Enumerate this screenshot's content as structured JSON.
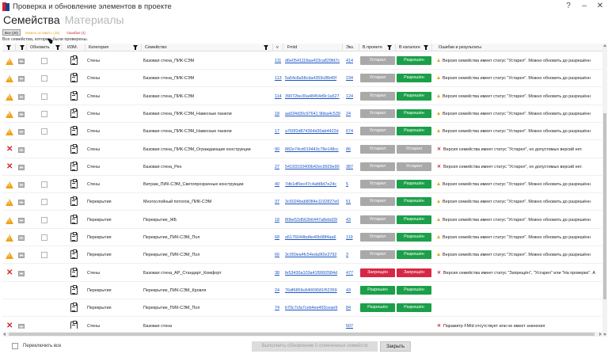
{
  "window": {
    "title": "Проверка и обновление элементов в проекте",
    "help": "?",
    "minimize": "–",
    "close": "✕"
  },
  "tabs": [
    {
      "label": "Семейства"
    },
    {
      "label": "Материалы"
    }
  ],
  "filters": {
    "all": "Все (20)",
    "warnings": "Можно оставить (15)",
    "errors": "Ошибки (4)"
  },
  "status_message": "Все семейства, которые были проверены.",
  "columns": {
    "update": "Обновить",
    "izm": "ИЗМ.",
    "category": "Категория",
    "family": "Семейство",
    "v": "v",
    "fmid": "FmId",
    "copies": "Экз.",
    "in_project": "В проекте",
    "in_catalog": "В каталоге",
    "results": "Ошибки и результаты"
  },
  "colors": {
    "warning": "#f0a21a",
    "error": "#d62828",
    "green": "#1b9f49",
    "gray": "#a9a9a9",
    "red": "#d62846",
    "link": "#1a55c4"
  },
  "rows": [
    {
      "status": "warning",
      "category": "Стены",
      "family": "Базовая стена_ПИК-СЭМ",
      "v": "111",
      "fmid": "d6e0541118aa433ca829fd7c",
      "copies": "414",
      "in_project": "Устарел",
      "in_project_color": "gray",
      "in_catalog": "Разрешён",
      "in_catalog_color": "green",
      "result": "Версия семейства имеет статус \"Устарел\". Можно обновить до разрешённ"
    },
    {
      "status": "warning",
      "category": "Стены",
      "family": "Базовая стена_ПИК-СЭМ",
      "v": "113",
      "fmid": "5a54c8a58cda4359c8fb40f",
      "copies": "234",
      "in_project": "Устарел",
      "in_project_color": "gray",
      "in_catalog": "Разрешён",
      "in_catalog_color": "green",
      "result": "Версия семейства имеет статус \"Устарел\". Можно обновить до разрешённ"
    },
    {
      "status": "warning",
      "category": "Стены",
      "family": "Базовая стена_ПИК-СЭМ",
      "v": "114",
      "fmid": "39072be30a48454d9c1a527",
      "copies": "124",
      "in_project": "Устарел",
      "in_project_color": "gray",
      "in_catalog": "Разрешён",
      "in_catalog_color": "green",
      "result": "Версия семейства имеет статус \"Устарел\". Можно обновить до разрешённ"
    },
    {
      "status": "warning",
      "category": "Стены",
      "family": "Базовая стена_ПИК-СЭМ_Навесные панели",
      "v": "18",
      "fmid": "aa034d30c97641 9bba4c539",
      "copies": "24",
      "in_project": "Устарел",
      "in_project_color": "gray",
      "in_catalog": "Разрешён",
      "in_catalog_color": "green",
      "result": "Версия семейства имеет статус \"Устарел\". Можно обновить до разрешённ"
    },
    {
      "status": "warning",
      "category": "Стены",
      "family": "Базовая стена_ПИК-СЭМ_Навесные панели",
      "v": "17",
      "fmid": "a760f2d874364d30ab4422d",
      "copies": "674",
      "in_project": "Устарел",
      "in_project_color": "gray",
      "in_catalog": "Разрешён",
      "in_catalog_color": "green",
      "result": "Версия семейства имеет статус \"Устарел\". Можно обновить до разрешённ"
    },
    {
      "status": "error",
      "category": "Стены",
      "family": "Базовая стена_ПИК-СЭМ_Ограждающие конструкции",
      "v": "90",
      "fmid": "882e74cd019443c78e148cc",
      "copies": "86",
      "in_project": "Устарел",
      "in_project_color": "gray",
      "in_catalog": "Устарел",
      "in_catalog_color": "gray",
      "result": "Версия семейства имеет статус \"Устарел\", но допустимых версий нет."
    },
    {
      "status": "error",
      "category": "Стены",
      "family": "Базовая стена_Рен",
      "v": "27",
      "fmid": "54193193400b42ec9929e90",
      "copies": "387",
      "in_project": "Устарел",
      "in_project_color": "gray",
      "in_catalog": "Устарел",
      "in_catalog_color": "gray",
      "result": "Версия семейства имеет статус \"Устарел\", но допустимых версий нет."
    },
    {
      "status": "warning",
      "category": "Стены",
      "family": "Витраж_ПИК-СЭМ_Светопрозрачные конструкции",
      "v": "40",
      "fmid": "7db1df0ec47c4afd8d7e24c",
      "copies": "5",
      "in_project": "Устарел",
      "in_project_color": "gray",
      "in_catalog": "Разрешён",
      "in_catalog_color": "green",
      "result": "Версия семейства имеет статус \"Устарел\". Можно обновить до разрешённ"
    },
    {
      "status": "warning",
      "category": "Перекрытия",
      "family": "Многослойный потолок_ПИК-СЭМ",
      "v": "37",
      "fmid": "3c6024bab8084e1192827e0",
      "copies": "51",
      "in_project": "Устарел",
      "in_project_color": "gray",
      "in_catalog": "Разрешён",
      "in_catalog_color": "green",
      "result": "Версия семейства имеет статус \"Устарел\". Можно обновить до разрешённ"
    },
    {
      "status": "warning",
      "category": "Перекрытия",
      "family": "Перекрытие_ЖБ",
      "v": "18",
      "fmid": "80be52d562b6447a8ebd39",
      "copies": "43",
      "in_project": "Устарел",
      "in_project_color": "gray",
      "in_catalog": "Разрешён",
      "in_catalog_color": "green",
      "result": "Версия семейства имеет статус \"Устарел\". Можно обновить до разрешённ"
    },
    {
      "status": "warning",
      "category": "Перекрытия",
      "family": "Перекрытие_ПИК-СЭМ_Пол",
      "v": "68",
      "fmid": "a5176044bd4e40b98f4aa6",
      "copies": "119",
      "in_project": "Устарел",
      "in_project_color": "gray",
      "in_catalog": "Разрешён",
      "in_catalog_color": "green",
      "result": "Версия семейства имеет статус \"Устарел\". Можно обновить до разрешённ"
    },
    {
      "status": "warning",
      "category": "Перекрытия",
      "family": "Перекрытие_ПИК-СЭМ_Пол",
      "v": "66",
      "fmid": "3c050ea4fc54eda9f2e3792",
      "copies": "3",
      "in_project": "Устарел",
      "in_project_color": "gray",
      "in_catalog": "Разрешён",
      "in_catalog_color": "green",
      "result": "Версия семейства имеет статус \"Устарел\". Можно обновить до разрешённ"
    },
    {
      "status": "error",
      "category": "Стены",
      "family": "Базовая стена_АР_Стандарт_Комфорт",
      "v": "38",
      "fmid": "fe53430a103a41f9992084d",
      "copies": "477",
      "in_project": "Запрещён",
      "in_project_color": "red",
      "in_catalog": "Запрещён",
      "in_catalog_color": "red",
      "result": "Версия семейства имеет статус \"Запрещён\", \"Устарел\" или \"На проверке\". А"
    },
    {
      "status": "none",
      "category": "Перекрытия",
      "family": "Перекрытие_ПИК-СЭМ_Кровля",
      "v": "24",
      "fmid": "76df6859c84069581f52359",
      "copies": "43",
      "in_project": "Разрешён",
      "in_project_color": "green",
      "in_catalog": "Разрешён",
      "in_catalog_color": "green",
      "result": ""
    },
    {
      "status": "none",
      "category": "Перекрытия",
      "family": "Перекрытие_ПИК-СЭМ_Пол",
      "v": "74",
      "fmid": "b70c7cfa7ceb4ee493ceae9",
      "copies": "84",
      "in_project": "Разрешён",
      "in_project_color": "green",
      "in_catalog": "Разрешён",
      "in_catalog_color": "green",
      "result": ""
    },
    {
      "status": "error",
      "category": "Стены",
      "family": "Базовая стена",
      "v": "",
      "fmid": "",
      "copies": "507",
      "in_project": "",
      "in_project_color": "",
      "in_catalog": "",
      "in_catalog_color": "",
      "result": "Параметр FMId отсутствует или не имеет значения"
    }
  ],
  "footer": {
    "toggle_all": "Переключить все",
    "apply": "Выполнить обновление 0 отмеченных семейств",
    "close": "Закрыть"
  }
}
